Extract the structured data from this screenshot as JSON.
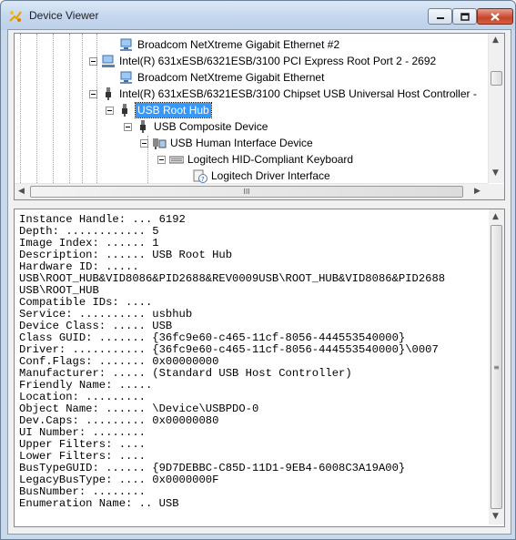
{
  "window": {
    "title": "Device Viewer"
  },
  "tree": {
    "items": [
      {
        "label": "Broadcom NetXtreme Gigabit Ethernet #2",
        "icon": "network-adapter-icon"
      },
      {
        "label": "Intel(R) 631xESB/6321ESB/3100 PCI Express Root Port 2 - 2692",
        "icon": "pci-device-icon"
      },
      {
        "label": "Broadcom NetXtreme Gigabit Ethernet",
        "icon": "network-adapter-icon"
      },
      {
        "label": "Intel(R) 631xESB/6321ESB/3100 Chipset USB Universal Host Controller -",
        "icon": "usb-icon"
      },
      {
        "label": "USB Root Hub",
        "icon": "usb-icon",
        "selected": true
      },
      {
        "label": "USB Composite Device",
        "icon": "usb-icon"
      },
      {
        "label": "USB Human Interface Device",
        "icon": "hid-device-icon"
      },
      {
        "label": "Logitech HID-Compliant Keyboard",
        "icon": "keyboard-icon"
      },
      {
        "label": "Logitech Driver Interface",
        "icon": "unknown-device-icon"
      }
    ],
    "hscroll_thumb_glyph": "III"
  },
  "details": {
    "lines": [
      "Instance Handle: ... 6192",
      "Depth: ............ 5",
      "Image Index: ...... 1",
      "Description: ...... USB Root Hub",
      "Hardware ID: .....",
      "USB\\ROOT_HUB&VID8086&PID2688&REV0009USB\\ROOT_HUB&VID8086&PID2688",
      "USB\\ROOT_HUB",
      "Compatible IDs: ....",
      "Service: .......... usbhub",
      "Device Class: ..... USB",
      "Class GUID: ....... {36fc9e60-c465-11cf-8056-444553540000}",
      "Driver: ........... {36fc9e60-c465-11cf-8056-444553540000}\\0007",
      "Conf.Flags: ....... 0x00000000",
      "Manufacturer: ..... (Standard USB Host Controller)",
      "Friendly Name: .....",
      "Location: .........",
      "Object Name: ...... \\Device\\USBPDO-0",
      "Dev.Caps: ......... 0x00000080",
      "UI Number: ........",
      "Upper Filters: ....",
      "Lower Filters: ....",
      "BusTypeGUID: ...... {9D7DEBBC-C85D-11D1-9EB4-6008C3A19A00}",
      "LegacyBusType: .... 0x0000000F",
      "BusNumber: ........",
      "Enumeration Name: .. USB"
    ]
  }
}
